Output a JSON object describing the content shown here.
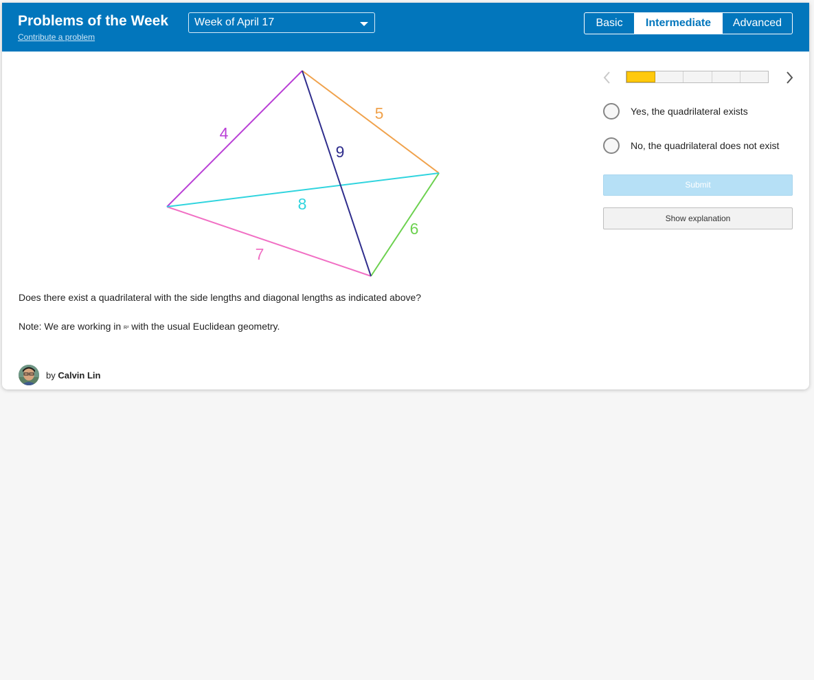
{
  "header": {
    "title": "Problems of the Week",
    "contribute_link": "Contribute a problem",
    "week_select": {
      "value": "Week of April 17"
    },
    "levels": [
      {
        "label": "Basic",
        "selected": false
      },
      {
        "label": "Intermediate",
        "selected": true
      },
      {
        "label": "Advanced",
        "selected": false
      }
    ]
  },
  "problem": {
    "figure": {
      "edges": [
        {
          "name": "side-left-top",
          "label": "4",
          "color": "#b93fd6"
        },
        {
          "name": "side-top-right",
          "label": "5",
          "color": "#f0a24c"
        },
        {
          "name": "side-right-bottom",
          "label": "6",
          "color": "#6cd14f"
        },
        {
          "name": "side-bottom-left",
          "label": "7",
          "color": "#f16fc4"
        },
        {
          "name": "diagonal-left-right",
          "label": "8",
          "color": "#2fd4de"
        },
        {
          "name": "diagonal-top-bottom",
          "label": "9",
          "color": "#2f2d8c"
        }
      ]
    },
    "question": "Does there exist a quadrilateral with the side lengths and diagonal lengths as indicated above?",
    "note_prefix": "Note: We are working in ",
    "note_symbol": "R²",
    "note_suffix": " with the usual Euclidean geometry.",
    "author": {
      "by": "by ",
      "name": "Calvin Lin"
    }
  },
  "sidebar": {
    "progress": {
      "current": 1,
      "total": 5
    },
    "options": [
      {
        "label": "Yes, the quadrilateral exists"
      },
      {
        "label": "No, the quadrilateral does not exist"
      }
    ],
    "submit_label": "Submit",
    "explanation_label": "Show explanation"
  },
  "colors": {
    "header_bg": "#0276bc",
    "progress_active": "#ffc90d",
    "submit_disabled": "#b6e0f6"
  }
}
